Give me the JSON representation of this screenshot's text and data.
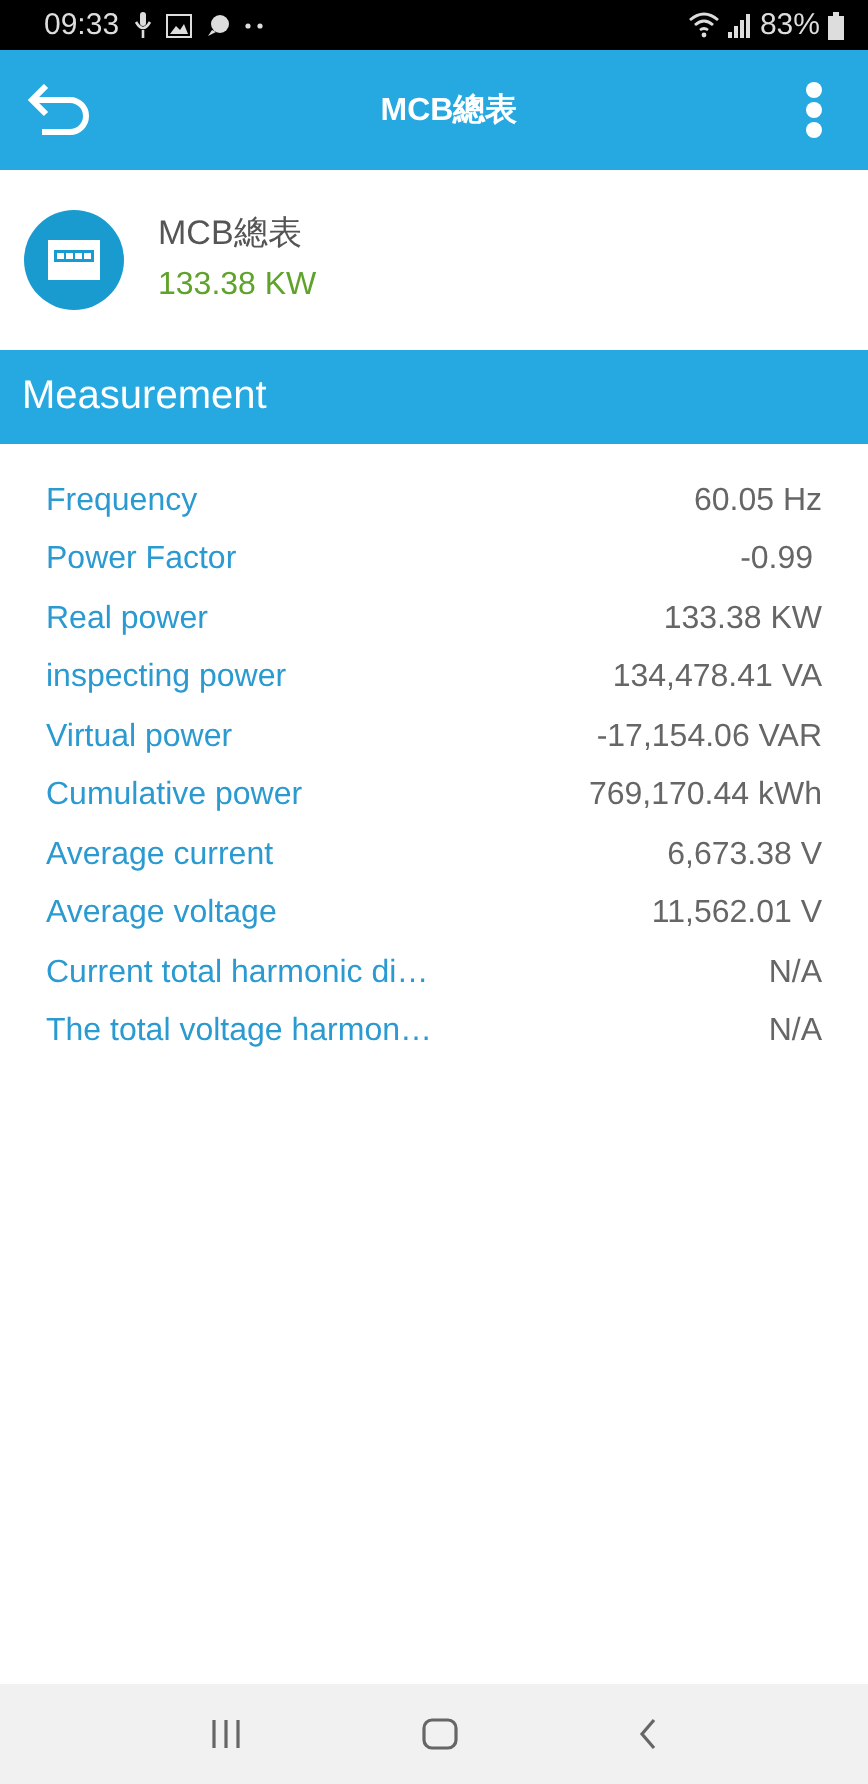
{
  "status_bar": {
    "time": "09:33",
    "battery": "83%"
  },
  "app_bar": {
    "title": "MCB總表"
  },
  "device": {
    "name": "MCB總表",
    "reading": "133.38  KW"
  },
  "section": {
    "title": "Measurement"
  },
  "measurements": [
    {
      "label": "Frequency",
      "value": "60.05 Hz"
    },
    {
      "label": "Power Factor",
      "value": "-0.99 "
    },
    {
      "label": "Real power",
      "value": "133.38 KW"
    },
    {
      "label": "inspecting power",
      "value": "134,478.41 VA"
    },
    {
      "label": "Virtual power",
      "value": "-17,154.06 VAR"
    },
    {
      "label": "Cumulative power",
      "value": "769,170.44 kWh"
    },
    {
      "label": "Average current",
      "value": "6,673.38 V"
    },
    {
      "label": "Average voltage",
      "value": "11,562.01 V"
    },
    {
      "label": "Current total harmonic di…",
      "value": "N/A"
    },
    {
      "label": "The total voltage harmon…",
      "value": "N/A"
    }
  ]
}
